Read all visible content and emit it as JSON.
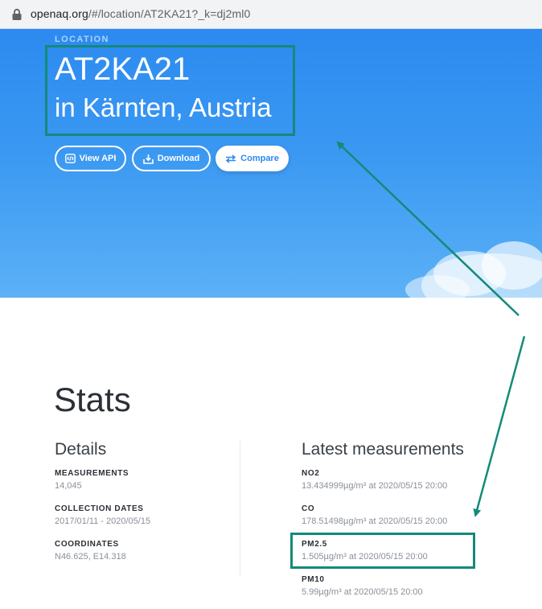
{
  "browser": {
    "url_host": "openaq.org",
    "url_path": "/#/location/AT2KA21?_k=dj2ml0"
  },
  "hero": {
    "eyebrow": "LOCATION",
    "title": "AT2KA21",
    "subtitle": "in Kärnten, Austria",
    "buttons": {
      "view_api": "View API",
      "download": "Download",
      "compare": "Compare"
    }
  },
  "stats": {
    "title": "Stats",
    "details": {
      "heading": "Details",
      "items": [
        {
          "label": "MEASUREMENTS",
          "value": "14,045"
        },
        {
          "label": "COLLECTION DATES",
          "value": "2017/01/11 - 2020/05/15"
        },
        {
          "label": "COORDINATES",
          "value": "N46.625, E14.318"
        }
      ]
    },
    "latest": {
      "heading": "Latest measurements",
      "items": [
        {
          "label": "NO2",
          "value": "13.434999µg/m³ at 2020/05/15 20:00"
        },
        {
          "label": "CO",
          "value": "178.51498µg/m³ at 2020/05/15 20:00"
        },
        {
          "label": "PM2.5",
          "value": "1.505µg/m³ at 2020/05/15 20:00"
        },
        {
          "label": "PM10",
          "value": "5.99µg/m³ at 2020/05/15 20:00"
        }
      ]
    }
  },
  "colors": {
    "annotation": "#148a78",
    "hero_blue": "#2c8af0",
    "accent": "#2c8af0"
  }
}
